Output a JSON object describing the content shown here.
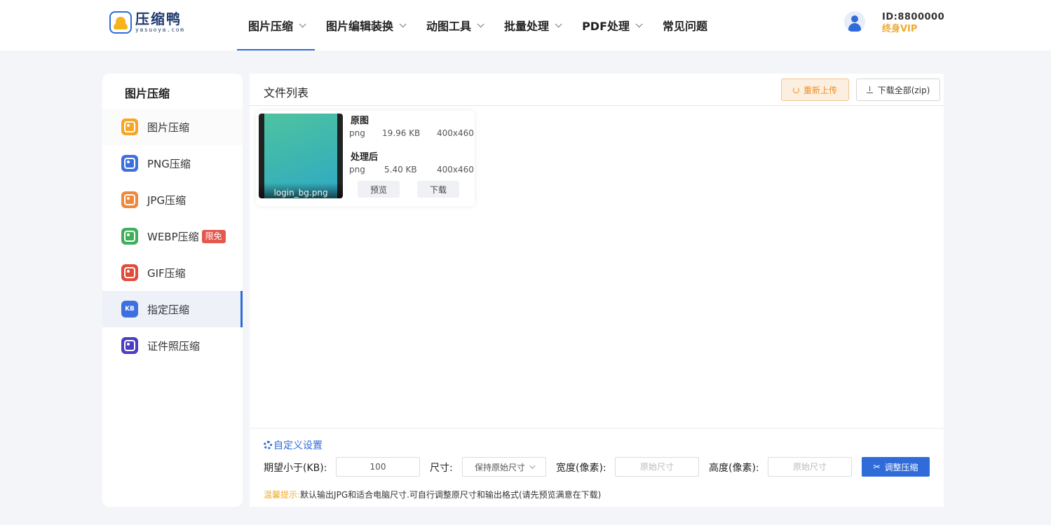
{
  "header": {
    "logo_title": "压缩鸭",
    "logo_sub": "yasuoya.com",
    "nav": [
      {
        "label": "图片压缩",
        "dropdown": true,
        "active": true
      },
      {
        "label": "图片编辑装换",
        "dropdown": true
      },
      {
        "label": "动图工具",
        "dropdown": true
      },
      {
        "label": "批量处理",
        "dropdown": true
      },
      {
        "label": "PDF处理",
        "dropdown": true
      },
      {
        "label": "常见问题",
        "dropdown": false
      }
    ],
    "user_id": "ID:8800000",
    "user_vip": "终身VIP"
  },
  "sidebar": {
    "title": "图片压缩",
    "items": [
      {
        "label": "图片压缩",
        "icon": "image-icon",
        "color": "#f5a623"
      },
      {
        "label": "PNG压缩",
        "icon": "png-icon",
        "color": "#3d6fe0"
      },
      {
        "label": "JPG压缩",
        "icon": "jpg-icon",
        "color": "#f0883a"
      },
      {
        "label": "WEBP压缩",
        "icon": "webp-icon",
        "color": "#3fae5a",
        "badge": "限免"
      },
      {
        "label": "GIF压缩",
        "icon": "gif-icon",
        "color": "#e04b3a"
      },
      {
        "label": "指定压缩",
        "icon": "kb-icon",
        "color": "#3d6fe0",
        "icon_text": "KB",
        "active": true
      },
      {
        "label": "证件照压缩",
        "icon": "id-photo-icon",
        "color": "#4b3dc4"
      }
    ]
  },
  "main": {
    "title": "文件列表",
    "reupload_label": "重新上传",
    "download_all_label": "下载全部(zip)",
    "file": {
      "name": "login_bg.png",
      "original_label": "原图",
      "original_format": "png",
      "original_size": "19.96 KB",
      "original_dims": "400x460",
      "processed_label": "处理后",
      "processed_format": "png",
      "processed_size": "5.40 KB",
      "processed_dims": "400x460",
      "preview_label": "预览",
      "download_label": "下载"
    }
  },
  "settings": {
    "title": "自定义设置",
    "size_label": "期望小于(KB):",
    "size_value": "100",
    "dim_label": "尺寸:",
    "dim_select": "保持原始尺寸",
    "width_label": "宽度(像素):",
    "width_placeholder": "原始尺寸",
    "height_label": "高度(像素):",
    "height_placeholder": "原始尺寸",
    "submit_label": "调整压缩",
    "tip_prefix": "温馨提示:",
    "tip_text": "默认输出JPG和适合电脑尺寸.可自行调整原尺寸和输出格式(请先预览满意在下载)"
  }
}
